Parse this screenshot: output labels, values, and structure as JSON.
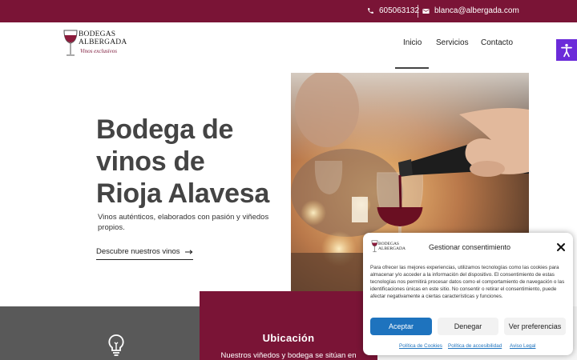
{
  "colors": {
    "brand": "#7a1436",
    "accessibility": "#6b2bd9",
    "accept_button": "#1e73be",
    "grey_section": "#595959"
  },
  "topbar": {
    "phone_icon": "phone-icon",
    "phone": "605063132",
    "mail_icon": "envelope-icon",
    "email": "blanca@albergada.com"
  },
  "logo": {
    "line1": "BODEGAS",
    "line2": "ALBERGADA",
    "tagline": "Vinos exclusivos"
  },
  "nav": {
    "items": [
      {
        "label": "Inicio",
        "active": true
      },
      {
        "label": "Servicios",
        "active": false
      },
      {
        "label": "Contacto",
        "active": false
      }
    ]
  },
  "accessibility": {
    "icon": "accessibility-icon"
  },
  "hero": {
    "title_lines": [
      "Bodega de",
      "vinos de",
      "Rioja Alavesa"
    ],
    "text": "Vinos auténticos, elaborados con pasión y viñedos propios.",
    "cta": "Descubre nuestros vinos",
    "cta_icon": "arrow-right-icon"
  },
  "sections": {
    "left_icon": "lightbulb-icon",
    "location_title": "Ubicación",
    "location_text": "Nuestros viñedos y bodega se sitúan en"
  },
  "consent": {
    "title": "Gestionar consentimiento",
    "body": "Para ofrecer las mejores experiencias, utilizamos tecnologías como las cookies para almacenar y/o acceder a la información del dispositivo. El consentimiento de estas tecnologías nos permitirá procesar datos como el comportamiento de navegación o las identificaciones únicas en este sitio. No consentir o retirar el consentimiento, puede afectar negativamente a ciertas características y funciones.",
    "accept": "Aceptar",
    "deny": "Denegar",
    "preferences": "Ver preferencias",
    "links": [
      "Política de Cookies",
      "Política de accesibilidad",
      "Aviso Legal"
    ]
  }
}
